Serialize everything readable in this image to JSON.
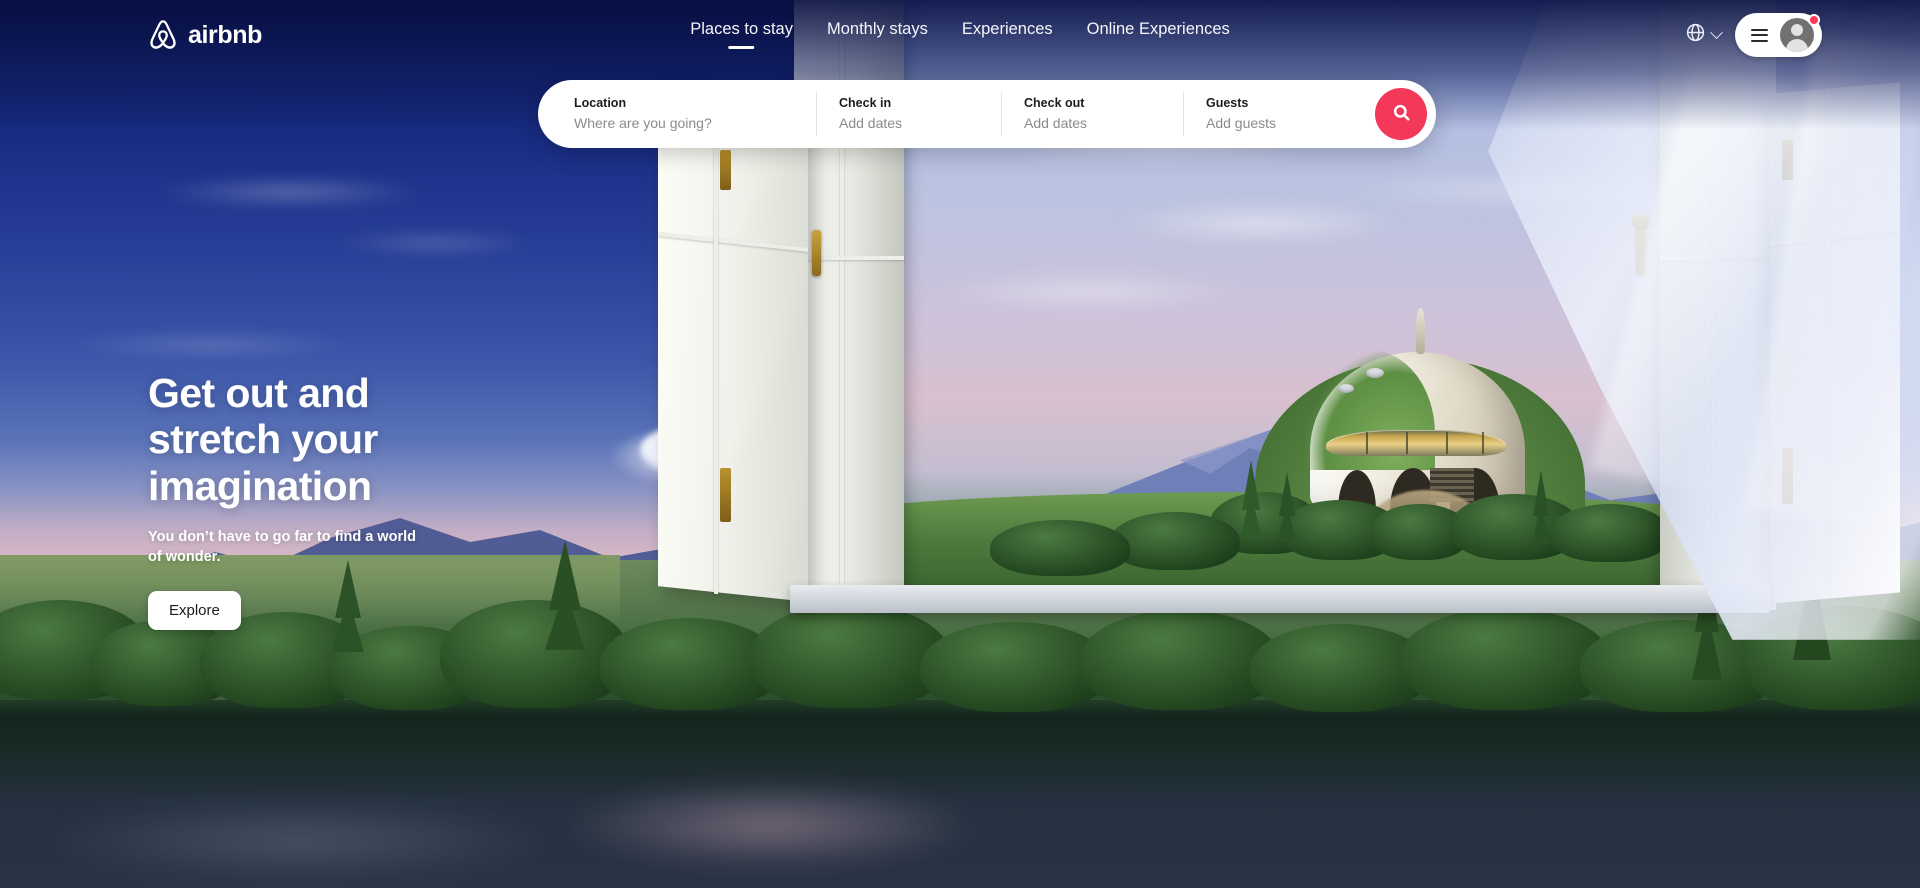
{
  "brand": {
    "name": "airbnb",
    "logo_icon": "airbnb-bel-logo"
  },
  "nav": {
    "items": [
      {
        "label": "Places to stay",
        "active": true
      },
      {
        "label": "Monthly stays",
        "active": false
      },
      {
        "label": "Experiences",
        "active": false
      },
      {
        "label": "Online Experiences",
        "active": false
      }
    ]
  },
  "header_right": {
    "globe_icon": "globe-icon",
    "chevron_icon": "chevron-down-icon",
    "menu_icon": "hamburger-menu-icon",
    "avatar_icon": "user-avatar-icon",
    "notification_badge": ""
  },
  "search": {
    "location": {
      "label": "Location",
      "value": "Where are you going?"
    },
    "checkin": {
      "label": "Check in",
      "value": "Add dates"
    },
    "checkout": {
      "label": "Check out",
      "value": "Add dates"
    },
    "guests": {
      "label": "Guests",
      "value": "Add guests"
    },
    "search_icon": "search-icon"
  },
  "hero": {
    "title_line1": "Get out and",
    "title_line2": "stretch your",
    "title_line3": "imagination",
    "subtitle": "You don’t have to go far to find a world of wonder.",
    "cta_label": "Explore"
  },
  "colors": {
    "accent": "#f4385a",
    "badge": "#ff385c",
    "sky_top": "#0b1450",
    "sky_mid": "#2a4199",
    "white": "#ffffff"
  }
}
